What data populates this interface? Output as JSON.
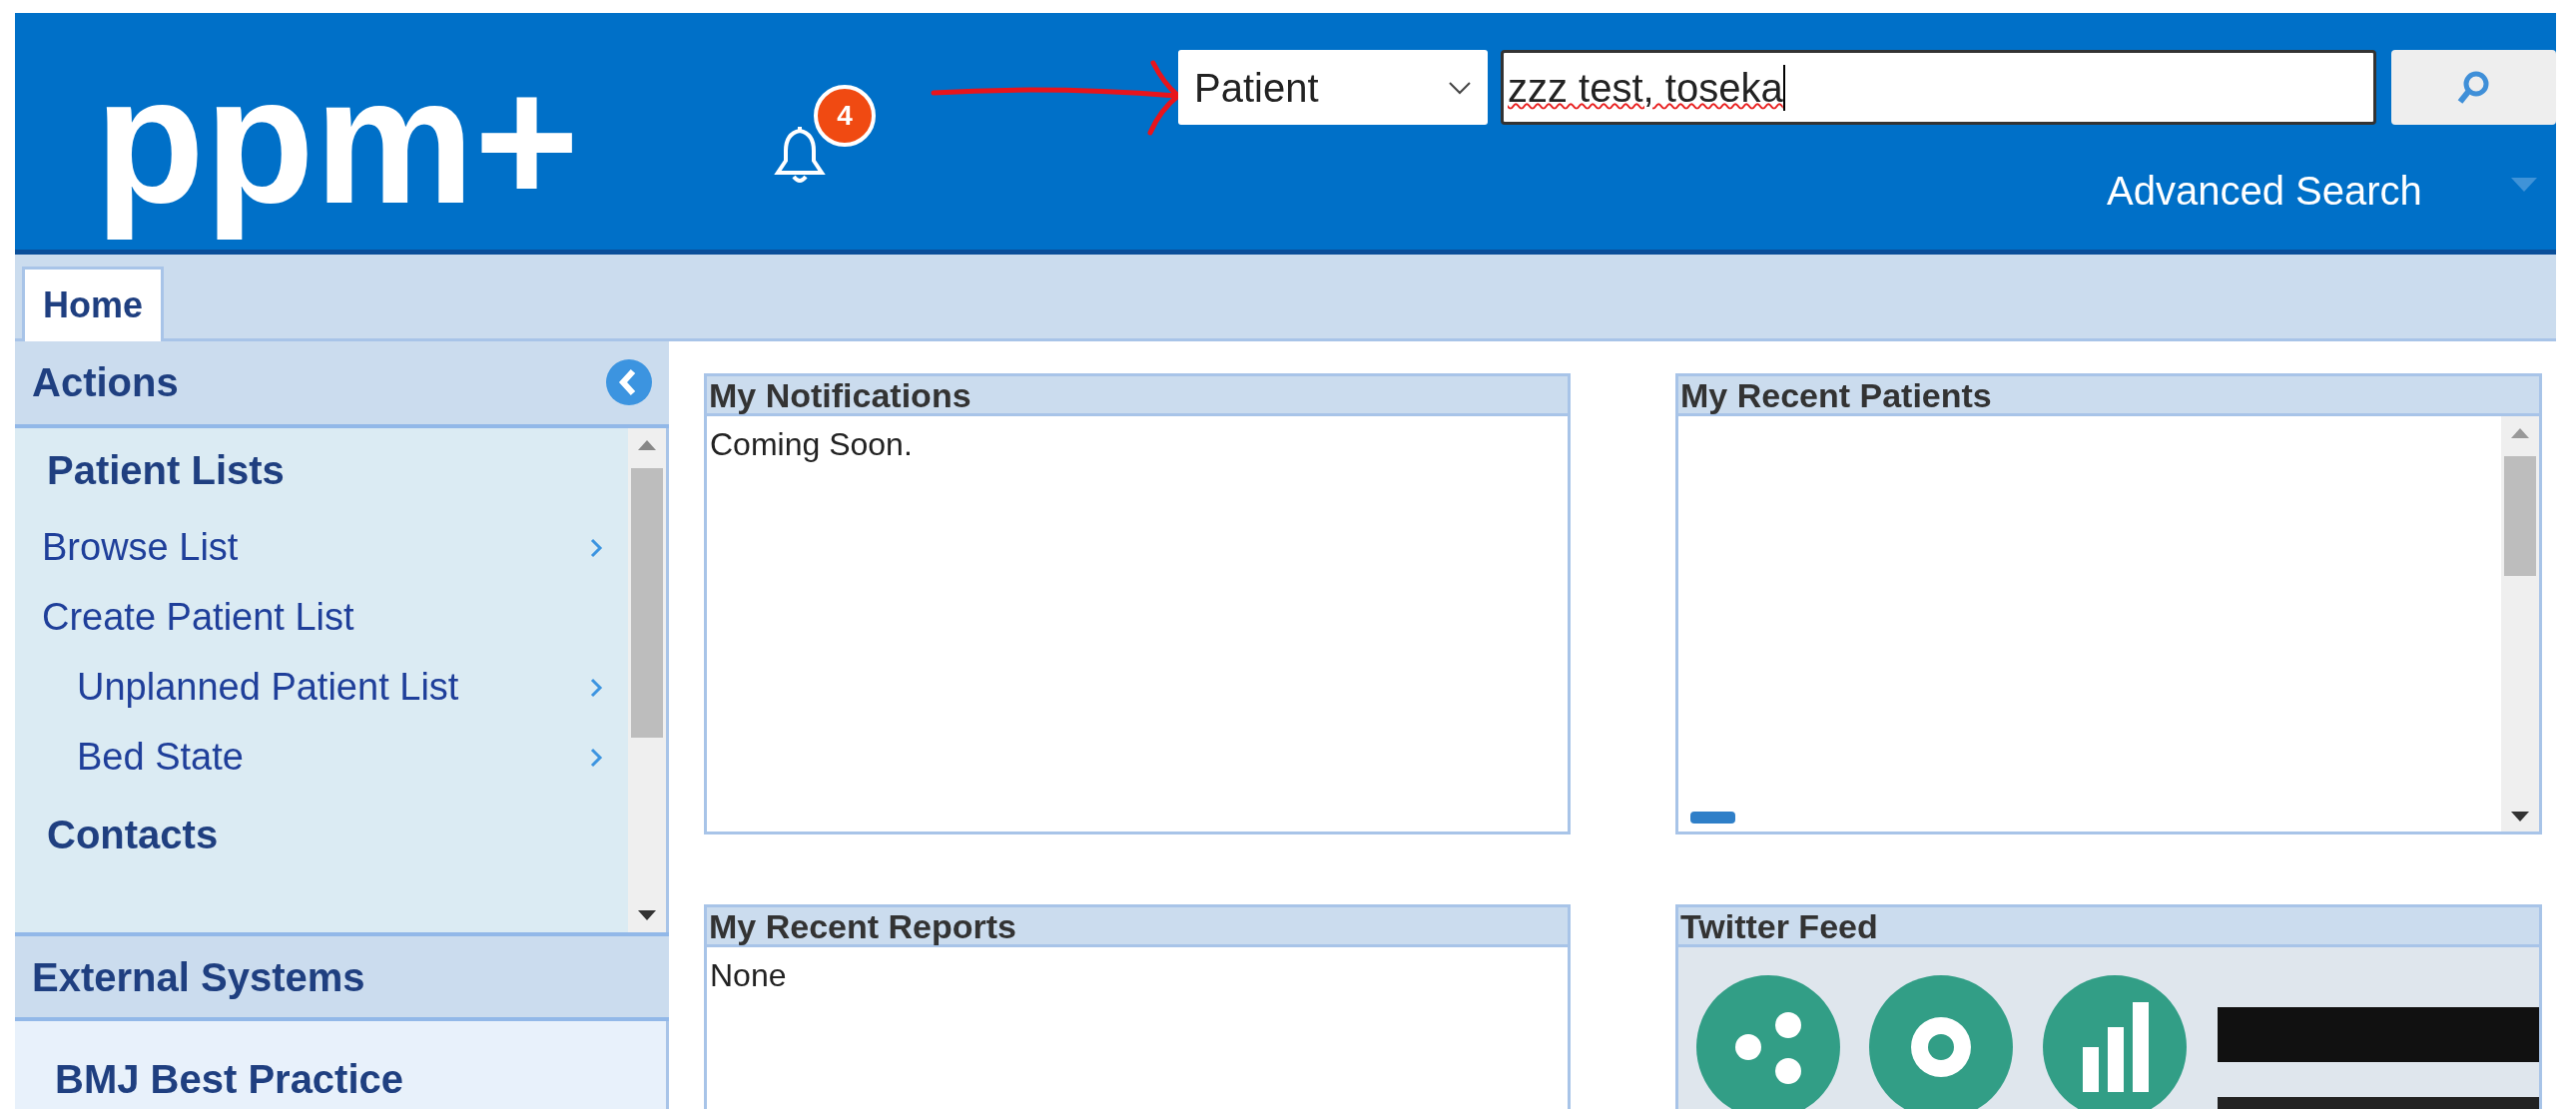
{
  "header": {
    "logo": "ppm+",
    "notification_count": "4",
    "search": {
      "scope": "Patient",
      "value": "zzz test, toseka"
    },
    "advanced_search": "Advanced Search"
  },
  "tabs": [
    {
      "label": "Home",
      "selected": true
    }
  ],
  "sidebar": {
    "title": "Actions",
    "sections": [
      {
        "title": "Patient Lists",
        "items": [
          {
            "label": "Browse List",
            "submenu": true
          },
          {
            "label": "Create Patient List",
            "submenu": false,
            "children": [
              {
                "label": "Unplanned Patient List",
                "submenu": true
              },
              {
                "label": "Bed State",
                "submenu": true
              }
            ]
          }
        ]
      },
      {
        "title": "Contacts"
      }
    ]
  },
  "external_systems": {
    "title": "External Systems",
    "items": [
      "BMJ Best Practice"
    ]
  },
  "panels": [
    {
      "title": "My Notifications",
      "kind": "text",
      "text": "Coming Soon."
    },
    {
      "title": "My Recent Patients",
      "kind": "list"
    },
    {
      "title": "My Recent Reports",
      "kind": "text",
      "text": "None"
    },
    {
      "title": "Twitter Feed",
      "kind": "picture"
    }
  ]
}
